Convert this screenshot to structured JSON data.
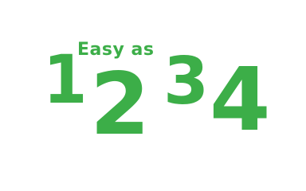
{
  "logo": {
    "tagline": "Easy as",
    "digits": [
      "1",
      "2",
      "3",
      "4"
    ],
    "color": "#3cae48",
    "background": "#ffffff"
  }
}
